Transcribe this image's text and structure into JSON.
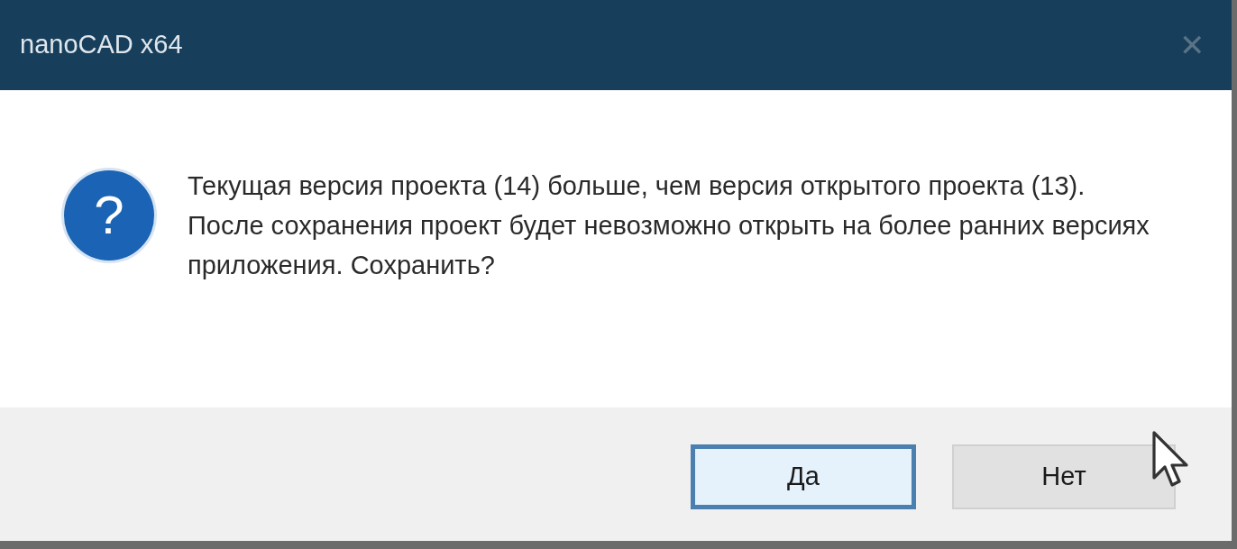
{
  "window": {
    "title": "nanoCAD x64",
    "close": "✕"
  },
  "message": "Текущая версия проекта (14) больше, чем версия открытого проекта (13). После сохранения проект будет невозможно открыть на более ранних версиях приложения. Сохранить?",
  "icon": {
    "glyph": "?"
  },
  "buttons": [
    {
      "label": "Да",
      "focused": true
    },
    {
      "label": "Нет",
      "focused": false
    }
  ]
}
